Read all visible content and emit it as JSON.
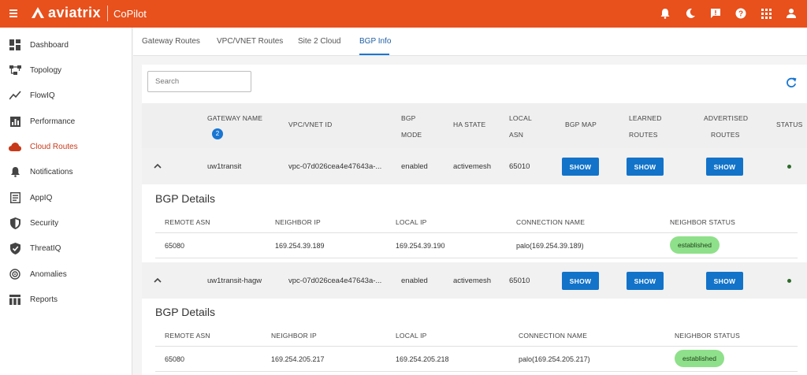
{
  "header": {
    "brand": "aviatrix",
    "product": "CoPilot",
    "brand_color": "#e8501c",
    "icons": [
      "bell-icon",
      "moon-icon",
      "feedback-icon",
      "help-icon",
      "apps-grid-icon",
      "user-icon"
    ]
  },
  "sidebar": {
    "items": [
      {
        "label": "Dashboard",
        "icon": "dashboard-icon"
      },
      {
        "label": "Topology",
        "icon": "topology-icon"
      },
      {
        "label": "FlowIQ",
        "icon": "flowiq-icon"
      },
      {
        "label": "Performance",
        "icon": "performance-icon"
      },
      {
        "label": "Cloud Routes",
        "icon": "cloud-icon",
        "active": true
      },
      {
        "label": "Notifications",
        "icon": "bell-icon"
      },
      {
        "label": "AppIQ",
        "icon": "appiq-icon"
      },
      {
        "label": "Security",
        "icon": "shield-icon"
      },
      {
        "label": "ThreatIQ",
        "icon": "shield-check-icon"
      },
      {
        "label": "Anomalies",
        "icon": "anomalies-icon"
      },
      {
        "label": "Reports",
        "icon": "reports-icon"
      }
    ]
  },
  "tabs": [
    "Gateway Routes",
    "VPC/VNET Routes",
    "Site 2 Cloud",
    "BGP Info"
  ],
  "active_tab": "BGP Info",
  "search": {
    "placeholder": "Search",
    "value": ""
  },
  "table": {
    "headers": {
      "gateway_name": "GATEWAY NAME",
      "gateway_count": "2",
      "vpc_id": "VPC/VNET ID",
      "bgp_mode_1": "BGP",
      "bgp_mode_2": "MODE",
      "ha_state": "HA STATE",
      "local_asn_1": "LOCAL",
      "local_asn_2": "ASN",
      "bgp_map": "BGP MAP",
      "learned_1": "LEARNED",
      "learned_2": "ROUTES",
      "advertised_1": "ADVERTISED",
      "advertised_2": "ROUTES",
      "status": "STATUS"
    },
    "button_label": "SHOW",
    "rows": [
      {
        "gateway_name": "uw1transit",
        "vpc_id": "vpc-07d026cea4e47643a-...",
        "bgp_mode": "enabled",
        "ha_state": "activemesh",
        "local_asn": "65010",
        "status_color": "#2e6b2a",
        "details": {
          "title": "BGP Details",
          "headers": [
            "REMOTE ASN",
            "NEIGHBOR IP",
            "LOCAL IP",
            "CONNECTION NAME",
            "NEIGHBOR STATUS"
          ],
          "rows": [
            {
              "remote_asn": "65080",
              "neighbor_ip": "169.254.39.189",
              "local_ip": "169.254.39.190",
              "connection_name": "palo(169.254.39.189)",
              "neighbor_status": "established"
            }
          ]
        }
      },
      {
        "gateway_name": "uw1transit-hagw",
        "vpc_id": "vpc-07d026cea4e47643a-...",
        "bgp_mode": "enabled",
        "ha_state": "activemesh",
        "local_asn": "65010",
        "status_color": "#2e6b2a",
        "details": {
          "title": "BGP Details",
          "headers": [
            "REMOTE ASN",
            "NEIGHBOR IP",
            "LOCAL IP",
            "CONNECTION NAME",
            "NEIGHBOR STATUS"
          ],
          "rows": [
            {
              "remote_asn": "65080",
              "neighbor_ip": "169.254.205.217",
              "local_ip": "169.254.205.218",
              "connection_name": "palo(169.254.205.217)",
              "neighbor_status": "established"
            }
          ]
        }
      }
    ]
  }
}
